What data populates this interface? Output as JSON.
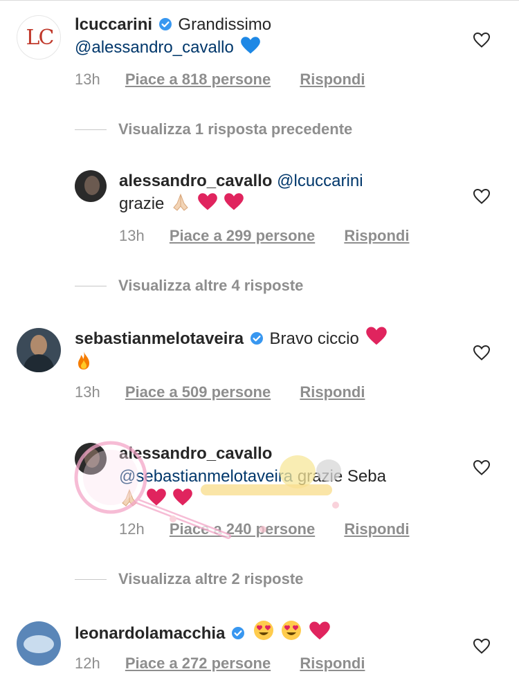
{
  "comments": [
    {
      "username": "lcuccarini",
      "avatar_text": "LC",
      "verified": true,
      "text_before": "Grandissimo",
      "mention": "@alessandro_cavallo",
      "emojis": [
        "blue-heart"
      ],
      "time": "13h",
      "likes": "Piace a 818 persone",
      "reply": "Rispondi"
    },
    {
      "view_replies": "Visualizza 1 risposta precedente"
    },
    {
      "username": "alessandro_cavallo",
      "mention": "@lcuccarini",
      "text": "grazie",
      "emojis": [
        "folded-hands",
        "red-heart",
        "red-heart"
      ],
      "time": "13h",
      "likes": "Piace a 299 persone",
      "reply": "Rispondi"
    },
    {
      "view_replies": "Visualizza altre 4 risposte"
    },
    {
      "username": "sebastianmelotaveira",
      "verified": true,
      "text": "Bravo ciccio",
      "emojis": [
        "red-heart",
        "fire"
      ],
      "time": "13h",
      "likes": "Piace a 509 persone",
      "reply": "Rispondi"
    },
    {
      "username": "alessandro_cavallo",
      "mention": "@sebastianmelotaveira",
      "text": "grazie Seba",
      "emojis": [
        "folded-hands",
        "red-heart",
        "red-heart"
      ],
      "time": "12h",
      "likes": "Piace a 240 persone",
      "reply": "Rispondi"
    },
    {
      "view_replies": "Visualizza altre 2 risposte"
    },
    {
      "username": "leonardolamacchia",
      "verified": true,
      "emojis": [
        "heart-eyes",
        "heart-eyes",
        "red-heart"
      ],
      "time": "12h",
      "likes": "Piace a 272 persone",
      "reply": "Rispondi"
    }
  ],
  "colors": {
    "mention": "#00376b",
    "meta_gray": "#8e8e8e",
    "verified_blue": "#3897f0",
    "heart_red": "#ed4956"
  }
}
